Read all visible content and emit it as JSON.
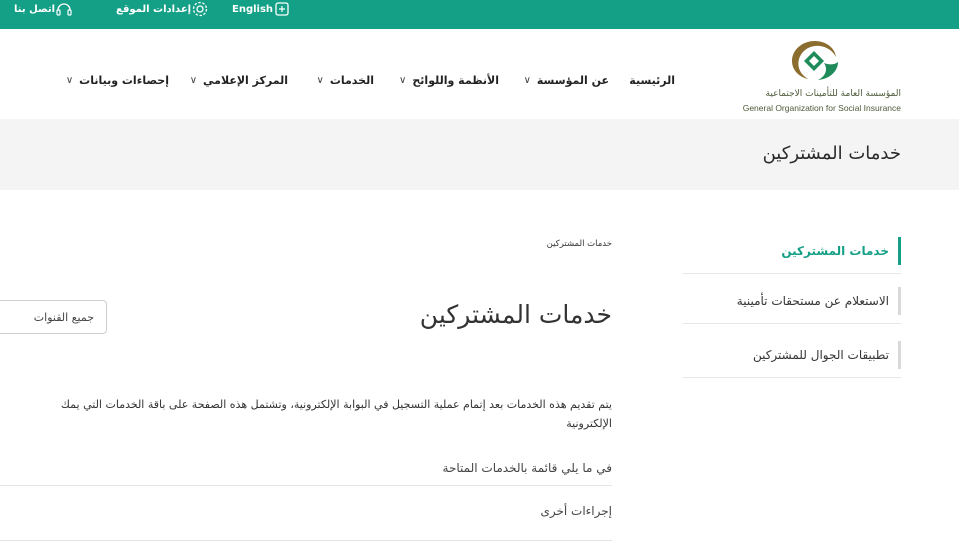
{
  "topbar": {
    "lang_label": "English",
    "settings_label": "إعدادات الموقع",
    "contact_label": "اتصل بنا",
    "colors": {
      "background": "#14a086",
      "text": "#ffffff"
    },
    "icons": {
      "lang": "globe-language-icon",
      "settings": "gear-icon",
      "contact": "headset-icon"
    }
  },
  "logo": {
    "name_ar": "المؤسسة العامة للتأمينات الاجتماعية",
    "name_en": "General Organization for Social Insurance"
  },
  "nav": {
    "items": [
      {
        "label": "الرئيسية",
        "has_dropdown": false
      },
      {
        "label": "عن المؤسسة",
        "has_dropdown": true
      },
      {
        "label": "الأنظمة واللوائح",
        "has_dropdown": true
      },
      {
        "label": "الخدمات",
        "has_dropdown": true
      },
      {
        "label": "المركز الإعلامي",
        "has_dropdown": true
      },
      {
        "label": "إحصاءات وبيانات",
        "has_dropdown": true
      }
    ],
    "chevron": "chevron-down-icon"
  },
  "page_band": {
    "title": "خدمات المشتركين"
  },
  "sidebar": {
    "items": [
      {
        "label": "خدمات المشتركين",
        "active": true
      },
      {
        "label": "الاستعلام عن مستحقات تأمينية",
        "active": false
      },
      {
        "label": "تطبيقات الجوال للمشتركين",
        "active": false
      }
    ],
    "accent": "#14a086"
  },
  "main": {
    "breadcrumb": "خدمات المشتركين",
    "title": "خدمات المشتركين",
    "channel_select": {
      "selected": "جميع القنوات"
    },
    "description_line1": "يتم تقديم هذه الخدمات بعد إتمام عملية التسجيل في البوابة الإلكترونية، وتشتمل هذه الصفحة على باقة الخدمات التي يمك",
    "description_line2": "الإلكترونية",
    "list_heading": "في ما يلي قائمة بالخدمات المتاحة",
    "list_items": [
      "إجراءات أخرى"
    ]
  }
}
